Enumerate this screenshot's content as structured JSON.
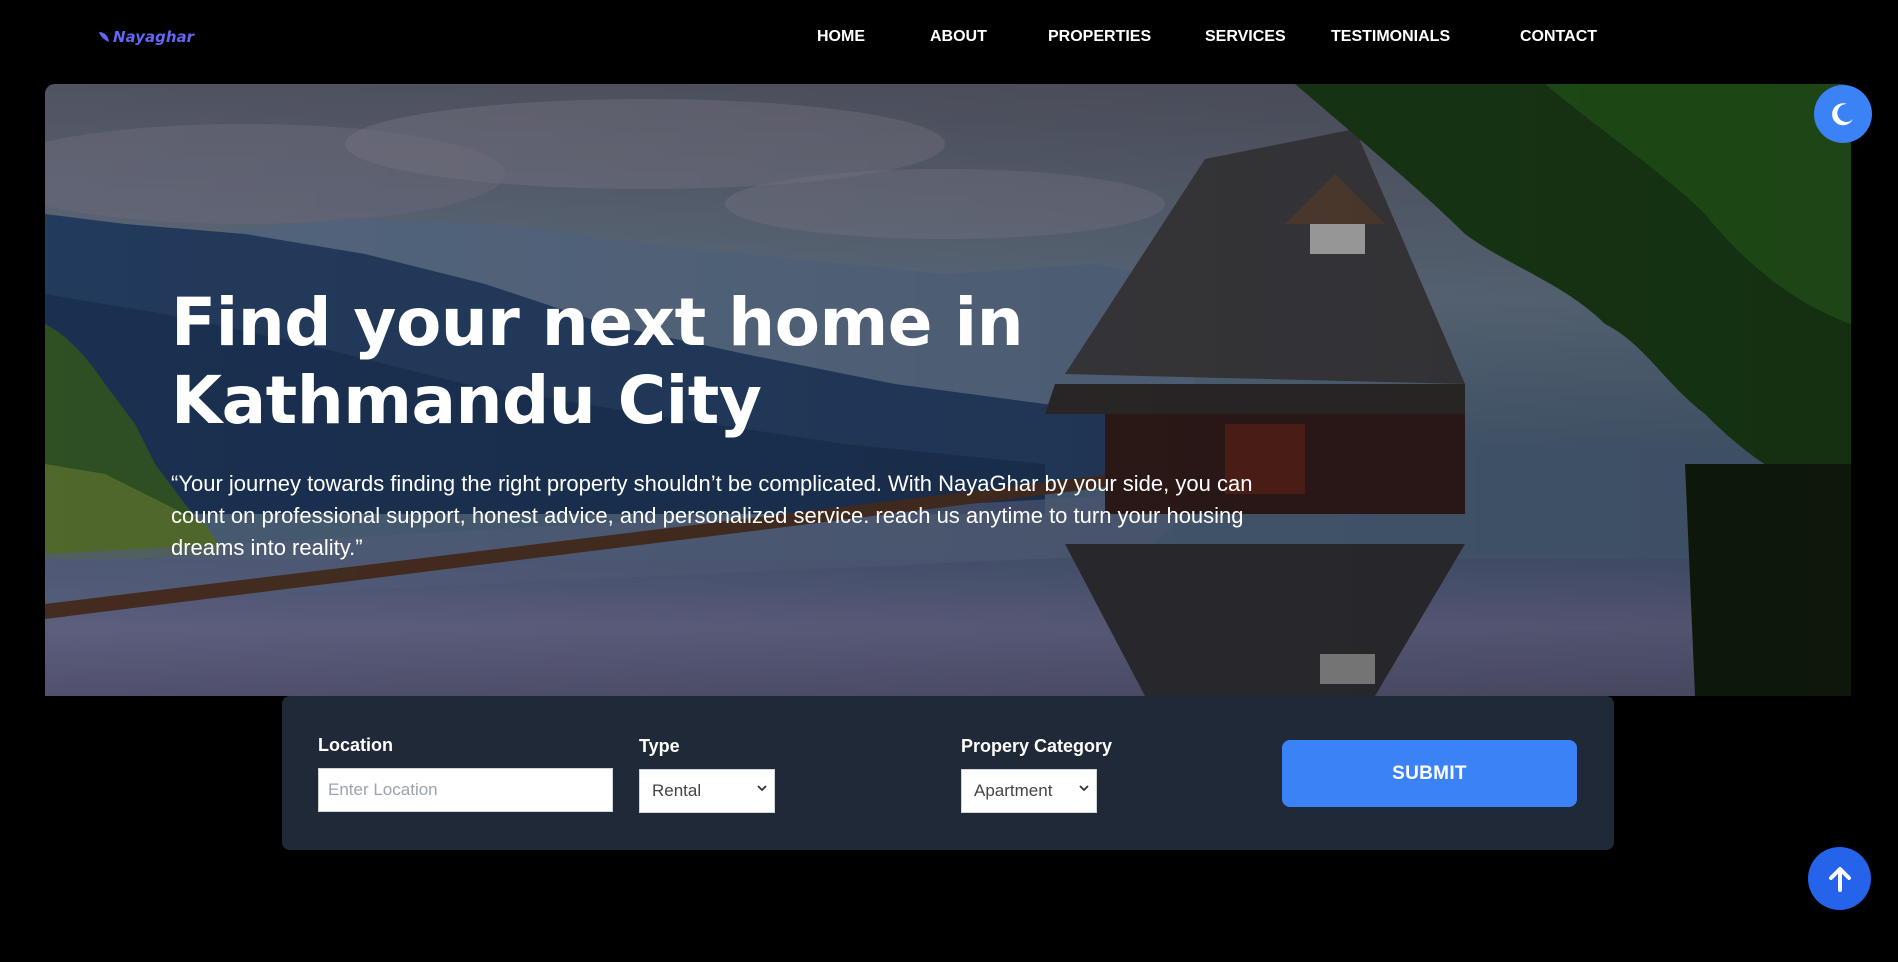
{
  "brand": {
    "name": "Nayaghar",
    "icon": "leaf-icon"
  },
  "nav": {
    "items": [
      {
        "label": "HOME"
      },
      {
        "label": "ABOUT"
      },
      {
        "label": "PROPERTIES"
      },
      {
        "label": "SERVICES"
      },
      {
        "label": "TESTIMONIALS"
      },
      {
        "label": "CONTACT"
      }
    ]
  },
  "hero": {
    "title_line1": "Find your next home in",
    "title_line2": "Kathmandu City",
    "quote": "“Your journey towards finding the right property shouldn’t be complicated. With NayaGhar by your side, you can count on professional support, honest advice, and personalized service. reach us anytime to turn your housing dreams into reality.”"
  },
  "search": {
    "location_label": "Location",
    "location_placeholder": "Enter Location",
    "type_label": "Type",
    "type_value": "Rental",
    "category_label": "Propery Category",
    "category_value": "Apartment",
    "submit_label": "SUBMIT"
  },
  "buttons": {
    "theme_icon": "moon-icon",
    "scroll_top_icon": "arrow-up-icon"
  },
  "colors": {
    "accent": "#3b82f6",
    "panel": "#1f2937",
    "brand": "#6366f1",
    "background": "#000000"
  }
}
